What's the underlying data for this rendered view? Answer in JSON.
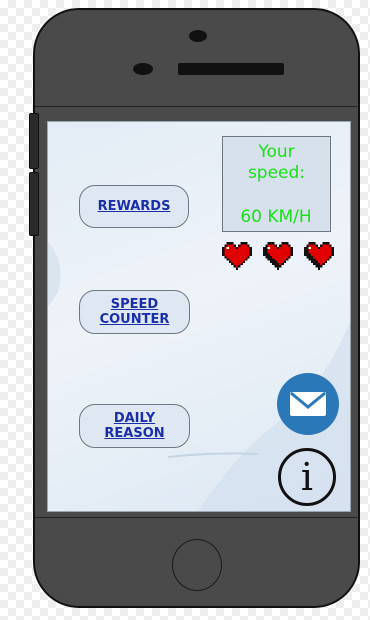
{
  "menu": {
    "rewards_label": "REWARDS",
    "speed_counter_label": "SPEED\nCOUNTER",
    "daily_reason_label": "DAILY\nREASON"
  },
  "speed_panel": {
    "label": "Your\nspeed:",
    "value": "60 KM/H",
    "text_color": "#19e019"
  },
  "lives": {
    "count": 3,
    "heart_color": "#e00000"
  },
  "actions": {
    "mail_icon": "envelope-icon",
    "mail_color": "#2b78b8",
    "info_icon": "info-icon",
    "info_glyph": "i"
  },
  "colors": {
    "button_text": "#1a2ea8",
    "phone_body": "#4a4a4a"
  }
}
